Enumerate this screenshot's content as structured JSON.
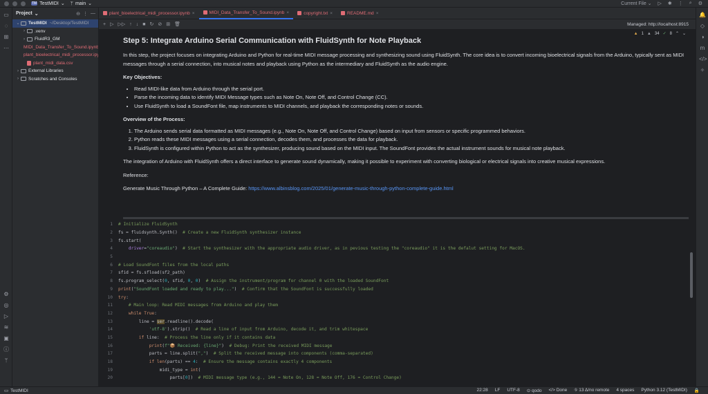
{
  "titlebar": {
    "project_badge": "TM",
    "project_name": "TestMIDI",
    "branch_icon": "branch-icon",
    "branch": "main",
    "run_config": "Current File"
  },
  "project_panel": {
    "title": "Project",
    "tree": [
      {
        "label": "TestMIDI",
        "suffix": "~/Desktop/TestMIDI",
        "indent": 0,
        "arrow": "⌄",
        "type": "folder",
        "selected": true
      },
      {
        "label": ".venv",
        "indent": 1,
        "arrow": "›",
        "type": "folder"
      },
      {
        "label": "FluidR3_GM",
        "indent": 1,
        "arrow": "›",
        "type": "folder"
      },
      {
        "label": "MIDI_Data_Transfer_To_Sound.ipynb",
        "indent": 1,
        "arrow": "",
        "type": "file-red"
      },
      {
        "label": "plant_bioelectrical_midi_processor.ipynb",
        "indent": 1,
        "arrow": "",
        "type": "file-red"
      },
      {
        "label": "plant_midi_data.csv",
        "indent": 1,
        "arrow": "",
        "type": "file-red"
      },
      {
        "label": "External Libraries",
        "indent": 0,
        "arrow": "›",
        "type": "lib"
      },
      {
        "label": "Scratches and Consoles",
        "indent": 0,
        "arrow": "›",
        "type": "scratch"
      }
    ]
  },
  "tabs": [
    {
      "label": "plant_bioelectrical_midi_processor.ipynb",
      "active": false
    },
    {
      "label": "MIDI_Data_Transfer_To_Sound.ipynb",
      "active": true
    },
    {
      "label": "copyright.txt",
      "active": false
    },
    {
      "label": "README.md",
      "active": false
    }
  ],
  "toolbar": {
    "cell_type": "Code",
    "managed": "Managed: http://localhost:8915"
  },
  "inspections": {
    "warnings": "1",
    "weak": "34",
    "typos": "8"
  },
  "markdown": {
    "heading": "Step 5: Integrate Arduino Serial Communication with FluidSynth for Note Playback",
    "intro": "In this step, the project focuses on integrating Arduino and Python for real-time MIDI message processing and synthesizing sound using FluidSynth. The core idea is to convert incoming bioelectrical signals from the Arduino, typically sent as MIDI messages through a serial connection, into musical notes and playback using Python as the intermediary and FluidSynth as the audio engine.",
    "objectives_title": "Key Objectives:",
    "objectives": [
      "Read MIDI-like data from Arduino through the serial port.",
      "Parse the incoming data to identify MIDI Message types such as Note On, Note Off, and Control Change (CC).",
      "Use FluidSynth to load a SoundFont file, map instruments to MIDI channels, and playback the corresponding notes or sounds."
    ],
    "overview_title": "Overview of the Process:",
    "overview": [
      "The Arduino sends serial data formatted as MIDI messages (e.g., Note On, Note Off, and Control Change) based on input from sensors or specific programmed behaviors.",
      "Python reads these MIDI messages using a serial connection, decodes them, and processes the data for playback.",
      "FluidSynth is configured within Python to act as the synthesizer, producing sound based on the MIDI input. The SoundFont provides the actual instrument sounds for musical note playback."
    ],
    "conclusion": "The integration of Arduino with FluidSynth offers a direct interface to generate sound dynamically, making it possible to experiment with converting biological or electrical signals into creative musical expressions.",
    "reference_label": "Reference:",
    "reference_text": "Generate Music Through Python – A Complete Guide:",
    "reference_link": "https://www.albinsblog.com/2025/01/generate-music-through-python-complete-guide.html"
  },
  "code_lines": [
    {
      "n": "1",
      "html": "<span class=\"cm\"># Initialize FluidSynth</span>"
    },
    {
      "n": "2",
      "html": "fs = fluidsynth.Synth()  <span class=\"cm\"># Create a new FluidSynth synthesizer instance</span>"
    },
    {
      "n": "3",
      "html": "fs.start("
    },
    {
      "n": "4",
      "html": "    <span class=\"par\">driver</span>=<span class=\"str\">\"coreaudio\"</span>)  <span class=\"cm\"># Start the synthesizer with the appropriate audio driver, as in pevious testing the \"coreaudio\" it is the defalut setting for MacOS.</span>"
    },
    {
      "n": "5",
      "html": ""
    },
    {
      "n": "6",
      "html": "<span class=\"cm\"># Load SoundFont files from the local paths</span>"
    },
    {
      "n": "7",
      "html": "sfid = fs.sfload(sf2_path)"
    },
    {
      "n": "8",
      "html": "fs.program_select(<span class=\"num\">0</span>, sfid, <span class=\"num\">0</span>, <span class=\"num\">0</span>)  <span class=\"cm\"># Assign the instrument/program for channel 0 with the loaded SoundFont</span>"
    },
    {
      "n": "9",
      "html": "<span class=\"kw\">print</span>(<span class=\"str\">\"SoundFont loaded and ready to play...\"</span>)  <span class=\"cm\"># Confirm that the SoundFont is successfully loaded</span>"
    },
    {
      "n": "10",
      "html": "<span class=\"kw\">try</span>:"
    },
    {
      "n": "11",
      "html": "    <span class=\"cm\"># Main loop: Read MIDI messages from Arduino and play them</span>"
    },
    {
      "n": "12",
      "html": "    <span class=\"kw\">while True</span>:"
    },
    {
      "n": "13",
      "html": "        line = <span class=\"hl\">ser</span>.readline().decode("
    },
    {
      "n": "14",
      "html": "            <span class=\"str\">'utf-8'</span>).strip()  <span class=\"cm\"># Read a line of input from Arduino, decode it, and trim whitespace</span>"
    },
    {
      "n": "15",
      "html": "        <span class=\"kw\">if</span> line:  <span class=\"cm\"># Process the line only if it contains data</span>"
    },
    {
      "n": "16",
      "html": "            <span class=\"kw\">print</span>(<span class=\"str\">f\"📦 Received: {line}\"</span>)  <span class=\"cm\"># Debug: Print the received MIDI message</span>"
    },
    {
      "n": "17",
      "html": "            parts = line.split(<span class=\"str\">\",\"</span>)  <span class=\"cm\"># Split the received message into components (comma-separated)</span>"
    },
    {
      "n": "18",
      "html": "            <span class=\"kw\">if</span> <span class=\"kw\">len</span>(parts) == <span class=\"num\">4</span>:  <span class=\"cm\"># Ensure the message contains exactly 4 components</span>"
    },
    {
      "n": "19",
      "html": "                midi_type = <span class=\"kw\">int</span>("
    },
    {
      "n": "20",
      "html": "                    parts[<span class=\"num\">0</span>])  <span class=\"cm\"># MIDI message type (e.g., 144 = Note On, 128 = Note Off, 176 = Control Change)</span>"
    }
  ],
  "statusbar": {
    "project": "TestMIDI",
    "position": "22:28",
    "line_sep": "LF",
    "encoding": "UTF-8",
    "qodo": "qodo",
    "done": "Done",
    "remote": "13 Δ/no remote",
    "indent": "4 spaces",
    "interpreter": "Python 3.12 (TestMIDI)"
  },
  "colors": {
    "accent": "#3574f0",
    "link": "#5896f7",
    "comment": "#7a9d5c",
    "keyword": "#cf8e6d",
    "string": "#6aab73"
  }
}
